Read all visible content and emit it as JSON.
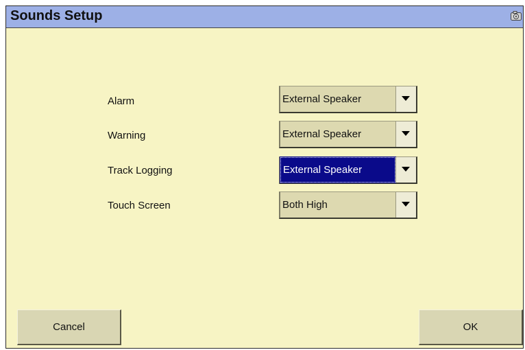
{
  "window": {
    "title": "Sounds Setup",
    "colors": {
      "background": "#f7f4c4",
      "titlebar": "#9db0e6",
      "selected": "#0a0a8a"
    }
  },
  "titlebar": {
    "icon": "camera-icon"
  },
  "settings": [
    {
      "label": "Alarm",
      "value": "External Speaker"
    },
    {
      "label": "Warning",
      "value": "External Speaker"
    },
    {
      "label": "Track Logging",
      "value": "External Speaker"
    },
    {
      "label": "Touch Screen",
      "value": "Both High"
    }
  ],
  "buttons": {
    "cancel": "Cancel",
    "ok": "OK"
  }
}
